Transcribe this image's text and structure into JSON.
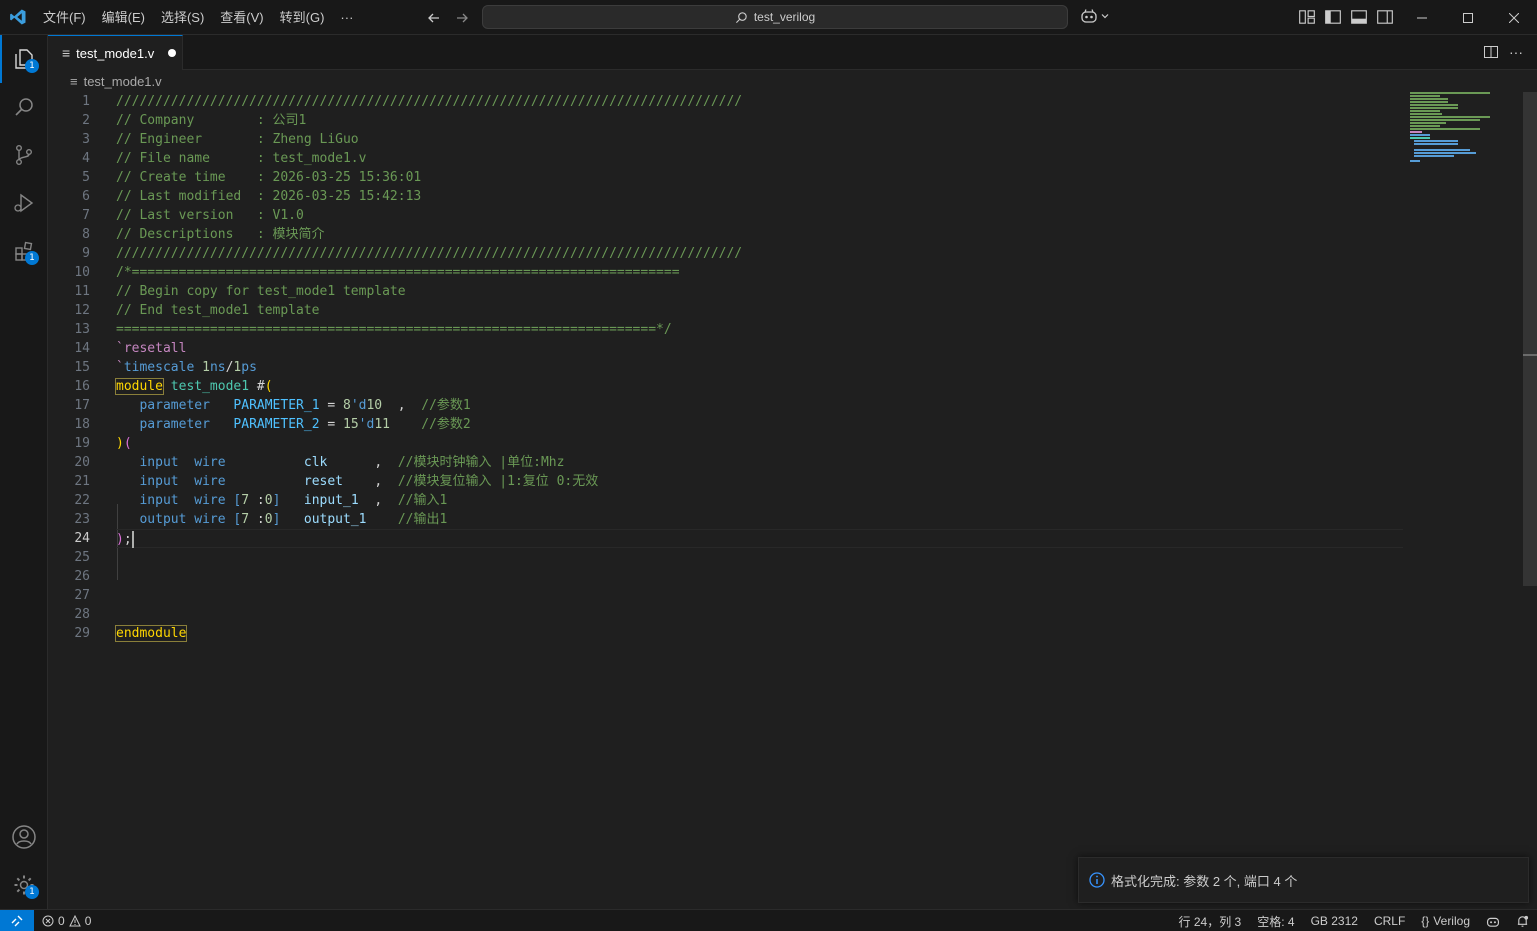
{
  "titlebar": {
    "menus": [
      "文件(F)",
      "编辑(E)",
      "选择(S)",
      "查看(V)",
      "转到(G)",
      "···"
    ],
    "search_text": "test_verilog",
    "app_accent": "#0078d4"
  },
  "activity": {
    "explorer_badge": "1",
    "extensions_badge": "1",
    "settings_badge": "1"
  },
  "tab": {
    "label": "test_mode1.v"
  },
  "breadcrumb": {
    "file": "test_mode1.v"
  },
  "editor": {
    "current_line": 24,
    "line_numbers": [
      "1",
      "2",
      "3",
      "4",
      "5",
      "6",
      "7",
      "8",
      "9",
      "10",
      "11",
      "12",
      "13",
      "14",
      "15",
      "16",
      "17",
      "18",
      "19",
      "20",
      "21",
      "22",
      "23",
      "24",
      "25",
      "26",
      "27",
      "28",
      "29"
    ],
    "lines": [
      [
        [
          "c-cm",
          "////////////////////////////////////////////////////////////////////////////////"
        ]
      ],
      [
        [
          "c-cm",
          "// Company        : 公司1"
        ]
      ],
      [
        [
          "c-cm",
          "// Engineer       : Zheng LiGuo"
        ]
      ],
      [
        [
          "c-cm",
          "// File name      : test_mode1.v"
        ]
      ],
      [
        [
          "c-cm",
          "// Create time    : 2026-03-25 15:36:01"
        ]
      ],
      [
        [
          "c-cm",
          "// Last modified  : 2026-03-25 15:42:13"
        ]
      ],
      [
        [
          "c-cm",
          "// Last version   : V1.0"
        ]
      ],
      [
        [
          "c-cm",
          "// Descriptions   : 模块简介"
        ]
      ],
      [
        [
          "c-cm",
          "////////////////////////////////////////////////////////////////////////////////"
        ]
      ],
      [
        [
          "c-cm",
          "/*======================================================================"
        ]
      ],
      [
        [
          "c-cm",
          "// Begin copy for test_mode1 template"
        ]
      ],
      [
        [
          "c-cm",
          "// End test_mode1 template"
        ]
      ],
      [
        [
          "c-cm",
          "=====================================================================*/"
        ]
      ],
      [
        [
          "c-dir",
          "`resetall"
        ]
      ],
      [
        [
          "c-dir",
          "`"
        ],
        [
          "c-kw",
          "timescale "
        ],
        [
          "c-num",
          "1"
        ],
        [
          "c-kw",
          "ns"
        ],
        [
          "c-op",
          "/"
        ],
        [
          "c-num",
          "1"
        ],
        [
          "c-kw",
          "ps"
        ]
      ],
      [
        [
          "hl-box",
          "module"
        ],
        [
          "c-op",
          " "
        ],
        [
          "c-id",
          "test_mode1"
        ],
        [
          "c-op",
          " #"
        ],
        [
          "c-br",
          "("
        ]
      ],
      [
        [
          "c-op",
          "   "
        ],
        [
          "c-kw",
          "parameter"
        ],
        [
          "c-op",
          "   "
        ],
        [
          "c-mod",
          "PARAMETER_1"
        ],
        [
          "c-op",
          " = "
        ],
        [
          "c-num",
          "8"
        ],
        [
          "c-kw",
          "'d"
        ],
        [
          "c-num",
          "10"
        ],
        [
          "c-op",
          "  ,  "
        ],
        [
          "c-cm",
          "//参数1"
        ]
      ],
      [
        [
          "c-op",
          "   "
        ],
        [
          "c-kw",
          "parameter"
        ],
        [
          "c-op",
          "   "
        ],
        [
          "c-mod",
          "PARAMETER_2"
        ],
        [
          "c-op",
          " = "
        ],
        [
          "c-num",
          "15"
        ],
        [
          "c-kw",
          "'d"
        ],
        [
          "c-num",
          "11"
        ],
        [
          "c-op",
          "    "
        ],
        [
          "c-cm",
          "//参数2"
        ]
      ],
      [
        [
          "c-br",
          ")"
        ],
        [
          "c-par",
          "("
        ]
      ],
      [
        [
          "c-op",
          "   "
        ],
        [
          "c-kw",
          "input"
        ],
        [
          "c-op",
          "  "
        ],
        [
          "c-kw",
          "wire"
        ],
        [
          "c-op",
          "          "
        ],
        [
          "c-var",
          "clk"
        ],
        [
          "c-op",
          "      ,  "
        ],
        [
          "c-cm",
          "//模块时钟输入 |单位:Mhz"
        ]
      ],
      [
        [
          "c-op",
          "   "
        ],
        [
          "c-kw",
          "input"
        ],
        [
          "c-op",
          "  "
        ],
        [
          "c-kw",
          "wire"
        ],
        [
          "c-op",
          "          "
        ],
        [
          "c-var",
          "reset"
        ],
        [
          "c-op",
          "    ,  "
        ],
        [
          "c-cm",
          "//模块复位输入 |1:复位 0:无效"
        ]
      ],
      [
        [
          "c-op",
          "   "
        ],
        [
          "c-kw",
          "input"
        ],
        [
          "c-op",
          "  "
        ],
        [
          "c-kw",
          "wire"
        ],
        [
          "c-op",
          " "
        ],
        [
          "c-kw",
          "["
        ],
        [
          "c-num",
          "7"
        ],
        [
          "c-op",
          " :"
        ],
        [
          "c-num",
          "0"
        ],
        [
          "c-kw",
          "]"
        ],
        [
          "c-op",
          "   "
        ],
        [
          "c-var",
          "input_1"
        ],
        [
          "c-op",
          "  ,  "
        ],
        [
          "c-cm",
          "//输入1"
        ]
      ],
      [
        [
          "c-op",
          "   "
        ],
        [
          "c-kw",
          "output"
        ],
        [
          "c-op",
          " "
        ],
        [
          "c-kw",
          "wire"
        ],
        [
          "c-op",
          " "
        ],
        [
          "c-kw",
          "["
        ],
        [
          "c-num",
          "7"
        ],
        [
          "c-op",
          " :"
        ],
        [
          "c-num",
          "0"
        ],
        [
          "c-kw",
          "]"
        ],
        [
          "c-op",
          "   "
        ],
        [
          "c-var",
          "output_1"
        ],
        [
          "c-op",
          "    "
        ],
        [
          "c-cm",
          "//输出1"
        ]
      ],
      [
        [
          "c-par",
          ")"
        ],
        [
          "c-op",
          ";"
        ]
      ],
      [],
      [],
      [],
      [],
      [
        [
          "hl-box",
          "endmodule"
        ]
      ]
    ]
  },
  "notification": {
    "text": "格式化完成: 参数 2 个, 端口 4 个"
  },
  "status": {
    "errors": "0",
    "warnings": "0",
    "position": "行 24，列 3",
    "spaces": "空格: 4",
    "encoding": "GB 2312",
    "eol": "CRLF",
    "language": "Verilog"
  }
}
